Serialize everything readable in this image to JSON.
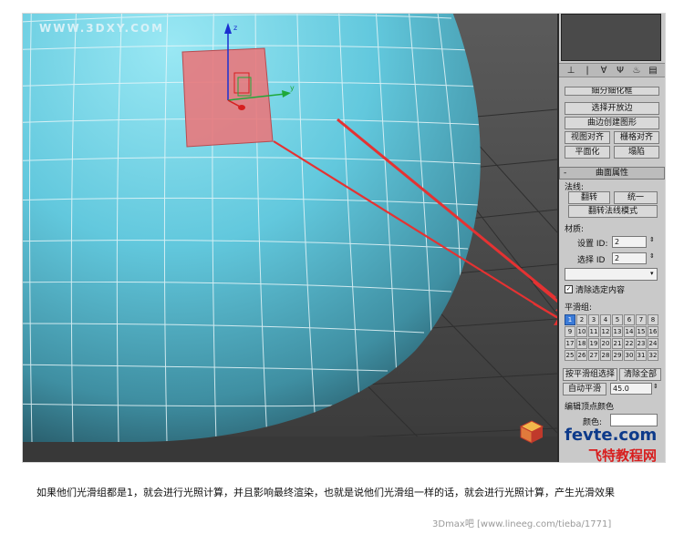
{
  "viewport": {
    "watermark": "WWW.3DXY.COM",
    "gizmo": {
      "x_axis_label": "x",
      "y_axis_label": "y",
      "z_axis_label": "z"
    },
    "colors": {
      "sphere": "#62c8dd",
      "selected_face": "#e8787c",
      "arrow": "#e53232",
      "wire": "#e7f6f9"
    }
  },
  "panel": {
    "toolbar_icons": [
      "pin-icon",
      "pipe-icon",
      "funnel-icon",
      "fork-icon",
      "flag-icon",
      "graph-icon"
    ],
    "buttons_top": {
      "cut_off_button": "細分細化框",
      "make_planar_edge": "选择开放边",
      "create_shape_from_edges": "曲边创建图形",
      "view_align": "视图对齐",
      "grid_align": "栅格对齐",
      "planarize": "平面化",
      "collapse": "塌陷"
    },
    "surface_properties": {
      "title": "曲面属性",
      "normals_label": "法线:",
      "flip": "翻转",
      "unify": "统一",
      "flip_normal_mode": "翻转法线模式"
    },
    "material": {
      "label": "材质:",
      "set_id_label": "设置 ID:",
      "set_id_value": "2",
      "select_id_label": "选择 ID",
      "select_id_value": "2",
      "dropdown_value": "",
      "clear_selection_label": "清除选定内容",
      "clear_selection_checked": true
    },
    "smoothing_groups": {
      "label": "平滑组:",
      "numbers": [
        "1",
        "2",
        "3",
        "4",
        "5",
        "6",
        "7",
        "8",
        "9",
        "10",
        "11",
        "12",
        "13",
        "14",
        "15",
        "16",
        "17",
        "18",
        "19",
        "20",
        "21",
        "22",
        "23",
        "24",
        "25",
        "26",
        "27",
        "28",
        "29",
        "30",
        "31",
        "32"
      ],
      "active": [
        "1"
      ],
      "select_by_sg": "按平滑组选择",
      "clear_all": "清除全部",
      "auto_smooth": "自动平滑",
      "auto_smooth_value": "45.0"
    },
    "vertex_colors": {
      "title": "编辑顶点颜色",
      "color_label": "颜色:"
    }
  },
  "logo": {
    "line1": "fevte.com",
    "line2": "飞特教程网"
  },
  "caption": "如果他们光滑组都是1，就会进行光照计算，并且影响最终渲染，也就是说他们光滑组一样的话，就会进行光照计算，产生光滑效果",
  "credit": "3Dmax吧 [www.lineeg.com/tieba/1771]"
}
